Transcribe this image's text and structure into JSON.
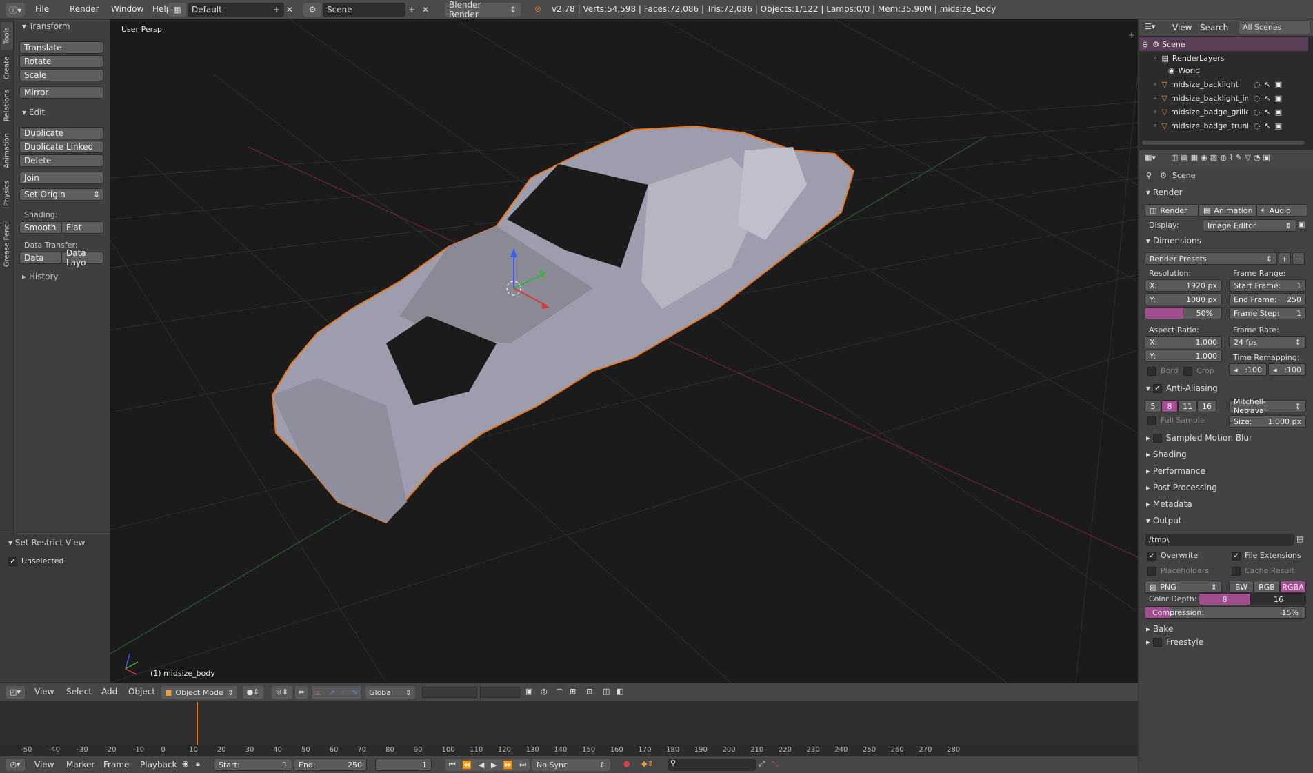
{
  "topbar": {
    "menus": [
      "File",
      "Render",
      "Window",
      "Help"
    ],
    "screen_layout": "Default",
    "scene": "Scene",
    "engine": "Blender Render",
    "stats": "v2.78 | Verts:54,598 | Faces:72,086 | Tris:72,086 | Objects:1/122 | Lamps:0/0 | Mem:35.90M | midsize_body"
  },
  "left_tabs": [
    "Tools",
    "Create",
    "Relations",
    "Animation",
    "Physics",
    "Grease Pencil"
  ],
  "tool_panel": {
    "transform_title": "Transform",
    "translate": "Translate",
    "rotate": "Rotate",
    "scale": "Scale",
    "mirror": "Mirror",
    "edit_title": "Edit",
    "duplicate": "Duplicate",
    "duplicate_linked": "Duplicate Linked",
    "delete": "Delete",
    "join": "Join",
    "set_origin": "Set Origin",
    "shading_label": "Shading:",
    "smooth": "Smooth",
    "flat": "Flat",
    "data_transfer_label": "Data Transfer:",
    "data": "Data",
    "data_layout": "Data Layo",
    "history_title": "History",
    "restrict_title": "Set Restrict View",
    "unselected": "Unselected"
  },
  "viewport": {
    "label": "User Persp",
    "object_label": "(1) midsize_body",
    "accent": "#e8781f"
  },
  "view3d_header": {
    "menus": [
      "View",
      "Select",
      "Add",
      "Object"
    ],
    "mode": "Object Mode",
    "orientation": "Global"
  },
  "timeline": {
    "ticks": [
      "-50",
      "-40",
      "-30",
      "-20",
      "-10",
      "0",
      "10",
      "20",
      "30",
      "40",
      "50",
      "60",
      "70",
      "80",
      "90",
      "100",
      "110",
      "120",
      "130",
      "140",
      "150",
      "160",
      "170",
      "180",
      "190",
      "200",
      "210",
      "220",
      "230",
      "240",
      "250",
      "260",
      "270",
      "280"
    ],
    "current_frame_marker": "0",
    "menus": [
      "View",
      "Marker",
      "Frame",
      "Playback"
    ],
    "start_label": "Start:",
    "start_value": "1",
    "end_label": "End:",
    "end_value": "250",
    "current_value": "1",
    "sync": "No Sync"
  },
  "outliner": {
    "menus": [
      "View",
      "Search"
    ],
    "scenes_select": "All Scenes",
    "items": [
      "Scene",
      "RenderLayers",
      "World",
      "midsize_backlight",
      "midsize_backlight_int",
      "midsize_badge_grille",
      "midsize_badge_trunk"
    ]
  },
  "properties": {
    "breadcrumb": "Scene",
    "render_title": "Render",
    "render_btn": "Render",
    "animation_btn": "Animation",
    "audio_btn": "Audio",
    "display_label": "Display:",
    "display_value": "Image Editor",
    "dimensions_title": "Dimensions",
    "render_presets": "Render Presets",
    "resolution_label": "Resolution:",
    "res_x_label": "X:",
    "res_x": "1920 px",
    "res_y_label": "Y:",
    "res_y": "1080 px",
    "res_percent": "50%",
    "res_percent_value": 50,
    "frame_range_label": "Frame Range:",
    "start_frame_label": "Start Frame:",
    "start_frame": "1",
    "end_frame_label": "End Frame:",
    "end_frame": "250",
    "frame_step_label": "Frame Step:",
    "frame_step": "1",
    "aspect_label": "Aspect Ratio:",
    "aspect_x_label": "X:",
    "aspect_x": "1.000",
    "aspect_y_label": "Y:",
    "aspect_y": "1.000",
    "frame_rate_label": "Frame Rate:",
    "frame_rate": "24 fps",
    "bord": "Bord",
    "crop": "Crop",
    "time_remap_label": "Time Remapping:",
    "remap_old": ":100",
    "remap_new": ":100",
    "aa_title": "Anti-Aliasing",
    "aa_samples": [
      "5",
      "8",
      "11",
      "16"
    ],
    "aa_filter": "Mitchell-Netravali",
    "full_sample": "Full Sample",
    "size_label": "Size:",
    "size_value": "1.000 px",
    "motion_blur": "Sampled Motion Blur",
    "shading": "Shading",
    "performance": "Performance",
    "post_processing": "Post Processing",
    "metadata": "Metadata",
    "output_title": "Output",
    "output_path": "/tmp\\",
    "overwrite": "Overwrite",
    "file_extensions": "File Extensions",
    "placeholders": "Placeholders",
    "cache_result": "Cache Result",
    "file_format": "PNG",
    "color_modes": [
      "BW",
      "RGB",
      "RGBA"
    ],
    "color_depth_label": "Color Depth:",
    "depth_8": "8",
    "depth_16": "16",
    "compression_label": "Compression:",
    "compression_value": "15%",
    "compression_percent": 15,
    "bake": "Bake",
    "freestyle": "Freestyle"
  }
}
